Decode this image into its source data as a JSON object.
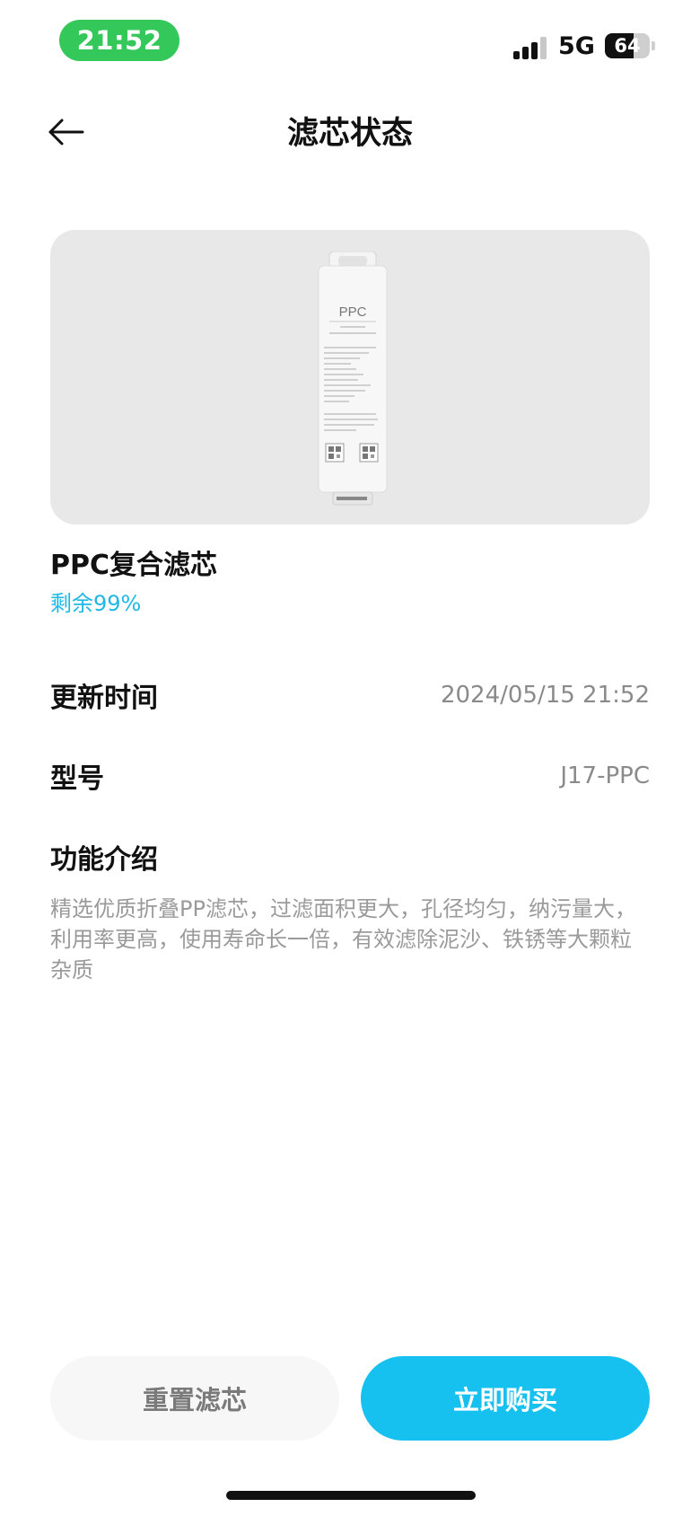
{
  "status_bar": {
    "time": "21:52",
    "network": "5G",
    "battery": "64",
    "battery_level": 0.64,
    "signal_bars": 3,
    "signal_bars_total": 4
  },
  "header": {
    "title": "滤芯状态",
    "back_icon": "arrow-left-icon"
  },
  "product": {
    "image_icon": "filter-cartridge-image",
    "cartridge_label": "PPC",
    "name": "PPC复合滤芯",
    "remaining": "剩余99%",
    "remaining_percent": 99
  },
  "details": {
    "updated_label": "更新时间",
    "updated_value": "2024/05/15 21:52",
    "model_label": "型号",
    "model_value": "J17-PPC"
  },
  "intro": {
    "title": "功能介绍",
    "text": "精选优质折叠PP滤芯，过滤面积更大，孔径均匀，纳污量大，利用率更高，使用寿命长一倍，有效滤除泥沙、铁锈等大颗粒杂质"
  },
  "actions": {
    "reset_label": "重置滤芯",
    "buy_label": "立即购买"
  },
  "colors": {
    "accent": "#17c1ef",
    "remaining_text": "#1fb8e6",
    "time_pill": "#34c759"
  }
}
